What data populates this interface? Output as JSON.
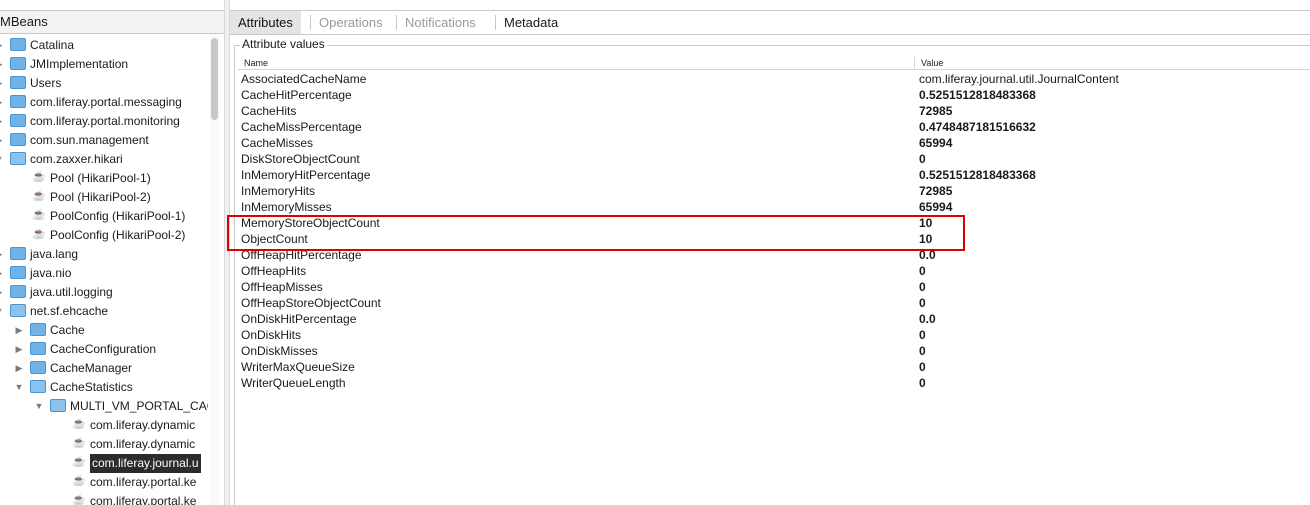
{
  "left_panel": {
    "header": "MBeans"
  },
  "tree": [
    {
      "label": "Catalina",
      "icon": "folder-icon",
      "expanded": false
    },
    {
      "label": "JMImplementation",
      "icon": "folder-icon",
      "expanded": false
    },
    {
      "label": "Users",
      "icon": "folder-icon",
      "expanded": false
    },
    {
      "label": "com.liferay.portal.messaging",
      "icon": "folder-icon",
      "expanded": false
    },
    {
      "label": "com.liferay.portal.monitoring",
      "icon": "folder-icon",
      "expanded": false
    },
    {
      "label": "com.sun.management",
      "icon": "folder-icon",
      "expanded": false
    },
    {
      "label": "com.zaxxer.hikari",
      "icon": "folder-open-icon",
      "expanded": true
    },
    {
      "label": "Pool (HikariPool-1)",
      "icon": "bean-icon"
    },
    {
      "label": "Pool (HikariPool-2)",
      "icon": "bean-icon"
    },
    {
      "label": "PoolConfig (HikariPool-1)",
      "icon": "bean-icon"
    },
    {
      "label": "PoolConfig (HikariPool-2)",
      "icon": "bean-icon"
    },
    {
      "label": "java.lang",
      "icon": "folder-icon",
      "expanded": false
    },
    {
      "label": "java.nio",
      "icon": "folder-icon",
      "expanded": false
    },
    {
      "label": "java.util.logging",
      "icon": "folder-icon",
      "expanded": false
    },
    {
      "label": "net.sf.ehcache",
      "icon": "folder-open-icon",
      "expanded": true
    },
    {
      "label": "Cache",
      "icon": "folder-icon",
      "expanded": false
    },
    {
      "label": "CacheConfiguration",
      "icon": "folder-icon",
      "expanded": false
    },
    {
      "label": "CacheManager",
      "icon": "folder-icon",
      "expanded": false
    },
    {
      "label": "CacheStatistics",
      "icon": "folder-open-icon",
      "expanded": true
    },
    {
      "label": "MULTI_VM_PORTAL_CAC",
      "icon": "folder-open-icon",
      "expanded": true
    },
    {
      "label": "com.liferay.dynamic",
      "icon": "bean-icon"
    },
    {
      "label": "com.liferay.dynamic",
      "icon": "bean-icon"
    },
    {
      "label": "com.liferay.journal.u",
      "icon": "bean-icon",
      "selected": true
    },
    {
      "label": "com.liferay.portal.ke",
      "icon": "bean-icon"
    },
    {
      "label": "com.liferay.portal.ke",
      "icon": "bean-icon"
    }
  ],
  "tabs": [
    {
      "label": "Attributes",
      "state": "active"
    },
    {
      "label": "Operations",
      "state": "disabled"
    },
    {
      "label": "Notifications",
      "state": "disabled"
    },
    {
      "label": "Metadata",
      "state": "normal"
    }
  ],
  "attributes": {
    "group_title": "Attribute values",
    "columns": {
      "name": "Name",
      "value": "Value"
    },
    "rows": [
      {
        "name": "AssociatedCacheName",
        "value": "com.liferay.journal.util.JournalContent",
        "bold": false
      },
      {
        "name": "CacheHitPercentage",
        "value": "0.5251512818483368",
        "bold": true
      },
      {
        "name": "CacheHits",
        "value": "72985",
        "bold": true
      },
      {
        "name": "CacheMissPercentage",
        "value": "0.4748487181516632",
        "bold": true
      },
      {
        "name": "CacheMisses",
        "value": "65994",
        "bold": true
      },
      {
        "name": "DiskStoreObjectCount",
        "value": "0",
        "bold": true
      },
      {
        "name": "InMemoryHitPercentage",
        "value": "0.5251512818483368",
        "bold": true
      },
      {
        "name": "InMemoryHits",
        "value": "72985",
        "bold": true
      },
      {
        "name": "InMemoryMisses",
        "value": "65994",
        "bold": true
      },
      {
        "name": "MemoryStoreObjectCount",
        "value": "10",
        "bold": true
      },
      {
        "name": "ObjectCount",
        "value": "10",
        "bold": true
      },
      {
        "name": "OffHeapHitPercentage",
        "value": "0.0",
        "bold": true
      },
      {
        "name": "OffHeapHits",
        "value": "0",
        "bold": true
      },
      {
        "name": "OffHeapMisses",
        "value": "0",
        "bold": true
      },
      {
        "name": "OffHeapStoreObjectCount",
        "value": "0",
        "bold": true
      },
      {
        "name": "OnDiskHitPercentage",
        "value": "0.0",
        "bold": true
      },
      {
        "name": "OnDiskHits",
        "value": "0",
        "bold": true
      },
      {
        "name": "OnDiskMisses",
        "value": "0",
        "bold": true
      },
      {
        "name": "WriterMaxQueueSize",
        "value": "0",
        "bold": true
      },
      {
        "name": "WriterQueueLength",
        "value": "0",
        "bold": true
      }
    ]
  },
  "colors": {
    "highlight": "#e00000",
    "selection": "#2b2b2b",
    "folder": "#6fb3e8"
  }
}
